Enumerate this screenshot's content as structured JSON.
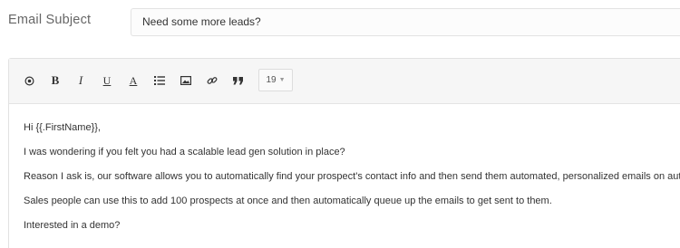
{
  "subject": {
    "label": "Email Subject",
    "value": "Need some more leads?"
  },
  "toolbar": {
    "buttons": [
      {
        "name": "record-icon",
        "glyph": "circle-dot"
      },
      {
        "name": "bold-icon",
        "glyph": "B"
      },
      {
        "name": "italic-icon",
        "glyph": "I"
      },
      {
        "name": "underline-icon",
        "glyph": "U"
      },
      {
        "name": "font-color-icon",
        "glyph": "A"
      },
      {
        "name": "list-icon",
        "glyph": "list"
      },
      {
        "name": "image-icon",
        "glyph": "image"
      },
      {
        "name": "link-icon",
        "glyph": "link"
      },
      {
        "name": "quote-icon",
        "glyph": "quote"
      }
    ],
    "font_size": "19"
  },
  "body": {
    "lines": [
      "Hi {{.FirstName}},",
      "I was wondering if you felt you had a scalable lead gen solution in place?",
      "Reason I ask is, our software allows you to automatically find your prospect's contact info and then send them automated, personalized emails on autopilot.",
      "Sales people can use this to add 100 prospects at once and then automatically queue up the emails to get sent to them.",
      "Interested in a demo?"
    ]
  }
}
